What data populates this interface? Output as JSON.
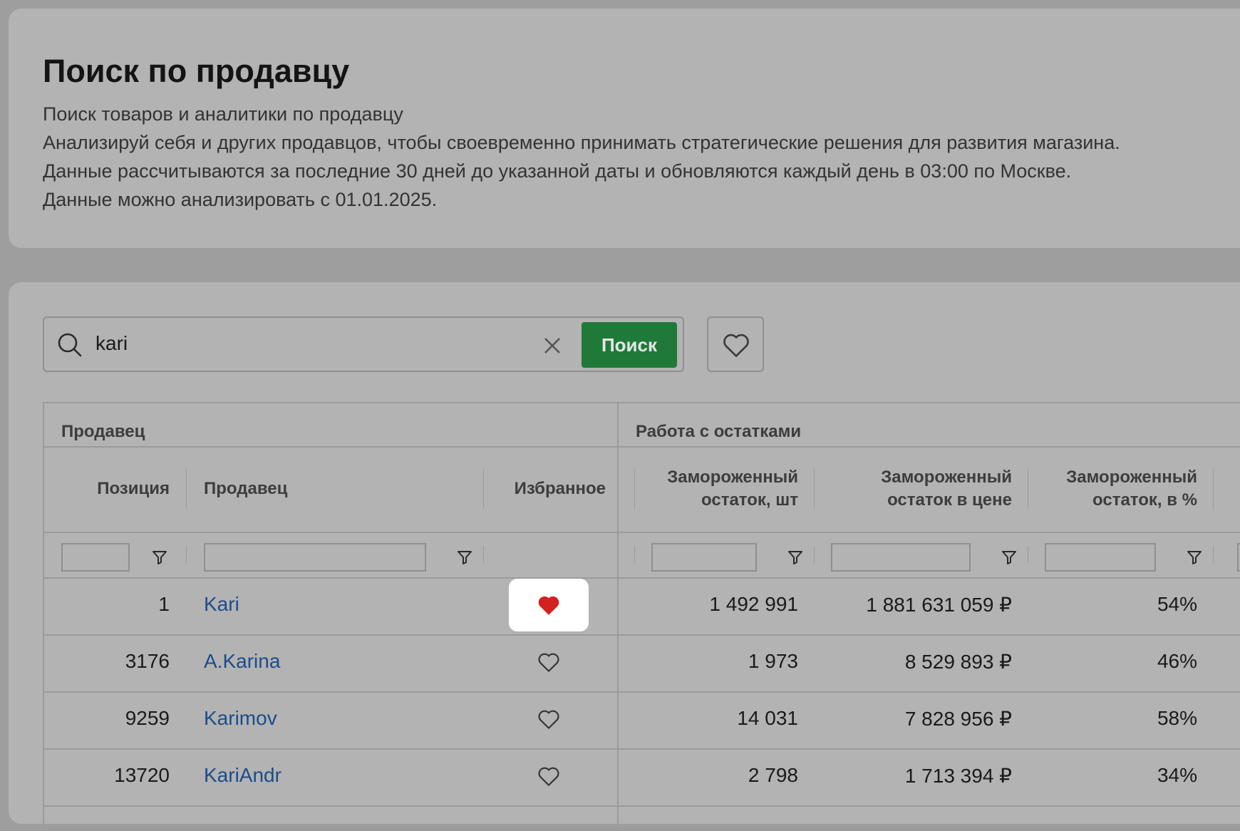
{
  "info": {
    "title": "Поиск по продавцу",
    "lines": [
      "Поиск товаров и аналитики по продавцу",
      "Анализируй себя и других продавцов, чтобы своевременно принимать стратегические решения для развития магазина.",
      "Данные рассчитываются за последние 30 дней до указанной даты и обновляются каждый день в 03:00 по Москве.",
      "Данные можно анализировать с 01.01.2025."
    ]
  },
  "search": {
    "value": "kari",
    "button_label": "Поиск",
    "icon": "search-icon",
    "clear_icon": "close-icon",
    "favorites_icon": "heart-outline-icon"
  },
  "table": {
    "groups": [
      "Продавец",
      "Работа с остатками"
    ],
    "columns": {
      "position": "Позиция",
      "seller": "Продавец",
      "favorite": "Избранное",
      "frozen_qty": [
        "Замороженный",
        "остаток, шт"
      ],
      "frozen_price": [
        "Замороженный",
        "остаток в цене"
      ],
      "frozen_pct": [
        "Замороженный",
        "остаток, в %"
      ]
    },
    "rows": [
      {
        "position": "1",
        "seller": "Kari",
        "favorite": true,
        "frozen_qty": "1 492 991",
        "frozen_price": "1 881 631 059 ₽",
        "frozen_pct": "54%"
      },
      {
        "position": "3176",
        "seller": "A.Karina",
        "favorite": false,
        "frozen_qty": "1 973",
        "frozen_price": "8 529 893 ₽",
        "frozen_pct": "46%"
      },
      {
        "position": "9259",
        "seller": "Karimov",
        "favorite": false,
        "frozen_qty": "14 031",
        "frozen_price": "7 828 956 ₽",
        "frozen_pct": "58%"
      },
      {
        "position": "13720",
        "seller": "KariAndr",
        "favorite": false,
        "frozen_qty": "2 798",
        "frozen_price": "1 713 394 ₽",
        "frozen_pct": "34%"
      }
    ]
  },
  "colors": {
    "accent_green": "#1f7a3a",
    "link_blue": "#1c4c8a",
    "heart_red": "#d32020"
  }
}
